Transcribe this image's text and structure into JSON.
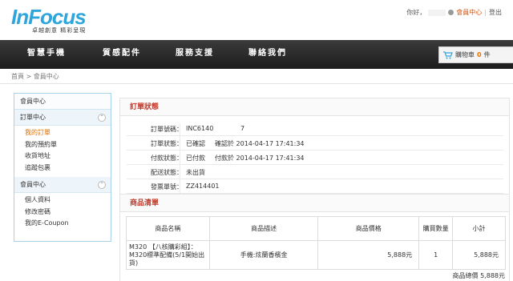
{
  "brand": {
    "logo_text": "InFocus",
    "tagline": "卓越創意 精彩呈現",
    "accent": "#2fa6db"
  },
  "header": {
    "greeting": "你好，",
    "member_center": "會員中心",
    "separator": "|",
    "logout": "登出"
  },
  "nav": {
    "items": [
      "智慧手機",
      "質感配件",
      "服務支援",
      "聯絡我們"
    ]
  },
  "cart": {
    "label": "購物車",
    "count": "0",
    "unit": "件"
  },
  "breadcrumb": "首頁 > 會員中心",
  "sidebar": {
    "title": "會員中心",
    "sections": [
      {
        "label": "訂單中心",
        "toggle": "⌃",
        "items": [
          "我的訂單",
          "我的預約單",
          "收貨地址",
          "追蹤包裹"
        ]
      },
      {
        "label": "會員中心",
        "toggle": "⌃",
        "items": [
          "個人資料",
          "修改密碼",
          "我的E-Coupon"
        ]
      }
    ],
    "active_item": "我的訂單"
  },
  "order_status": {
    "title": "訂單狀態",
    "rows": [
      {
        "label": "訂單號碼：",
        "value": "INC6140",
        "extra": "7"
      },
      {
        "label": "訂單狀態：",
        "value": "已確認",
        "extra": "確認於 2014-04-17 17:41:34"
      },
      {
        "label": "付款狀態：",
        "value": "已付款",
        "extra": "付款於 2014-04-17 17:41:34"
      },
      {
        "label": "配送狀態：",
        "value": "未出貨",
        "extra": ""
      },
      {
        "label": "發票單號：",
        "value": "ZZ414401",
        "extra": ""
      }
    ]
  },
  "items": {
    "title": "商品清單",
    "headers": [
      "商品名稱",
      "商品描述",
      "商品價格",
      "購買數量",
      "小計"
    ],
    "rows": [
      {
        "name": "M320 【八核購彩組】：M320標準配備(5/1開始出貨)",
        "desc": "手機:炫蘭香檳金",
        "price": "5,888元",
        "qty": "1",
        "subtotal": "5,888元"
      }
    ],
    "total_label": "商品總價",
    "total_value": "5,888元"
  }
}
